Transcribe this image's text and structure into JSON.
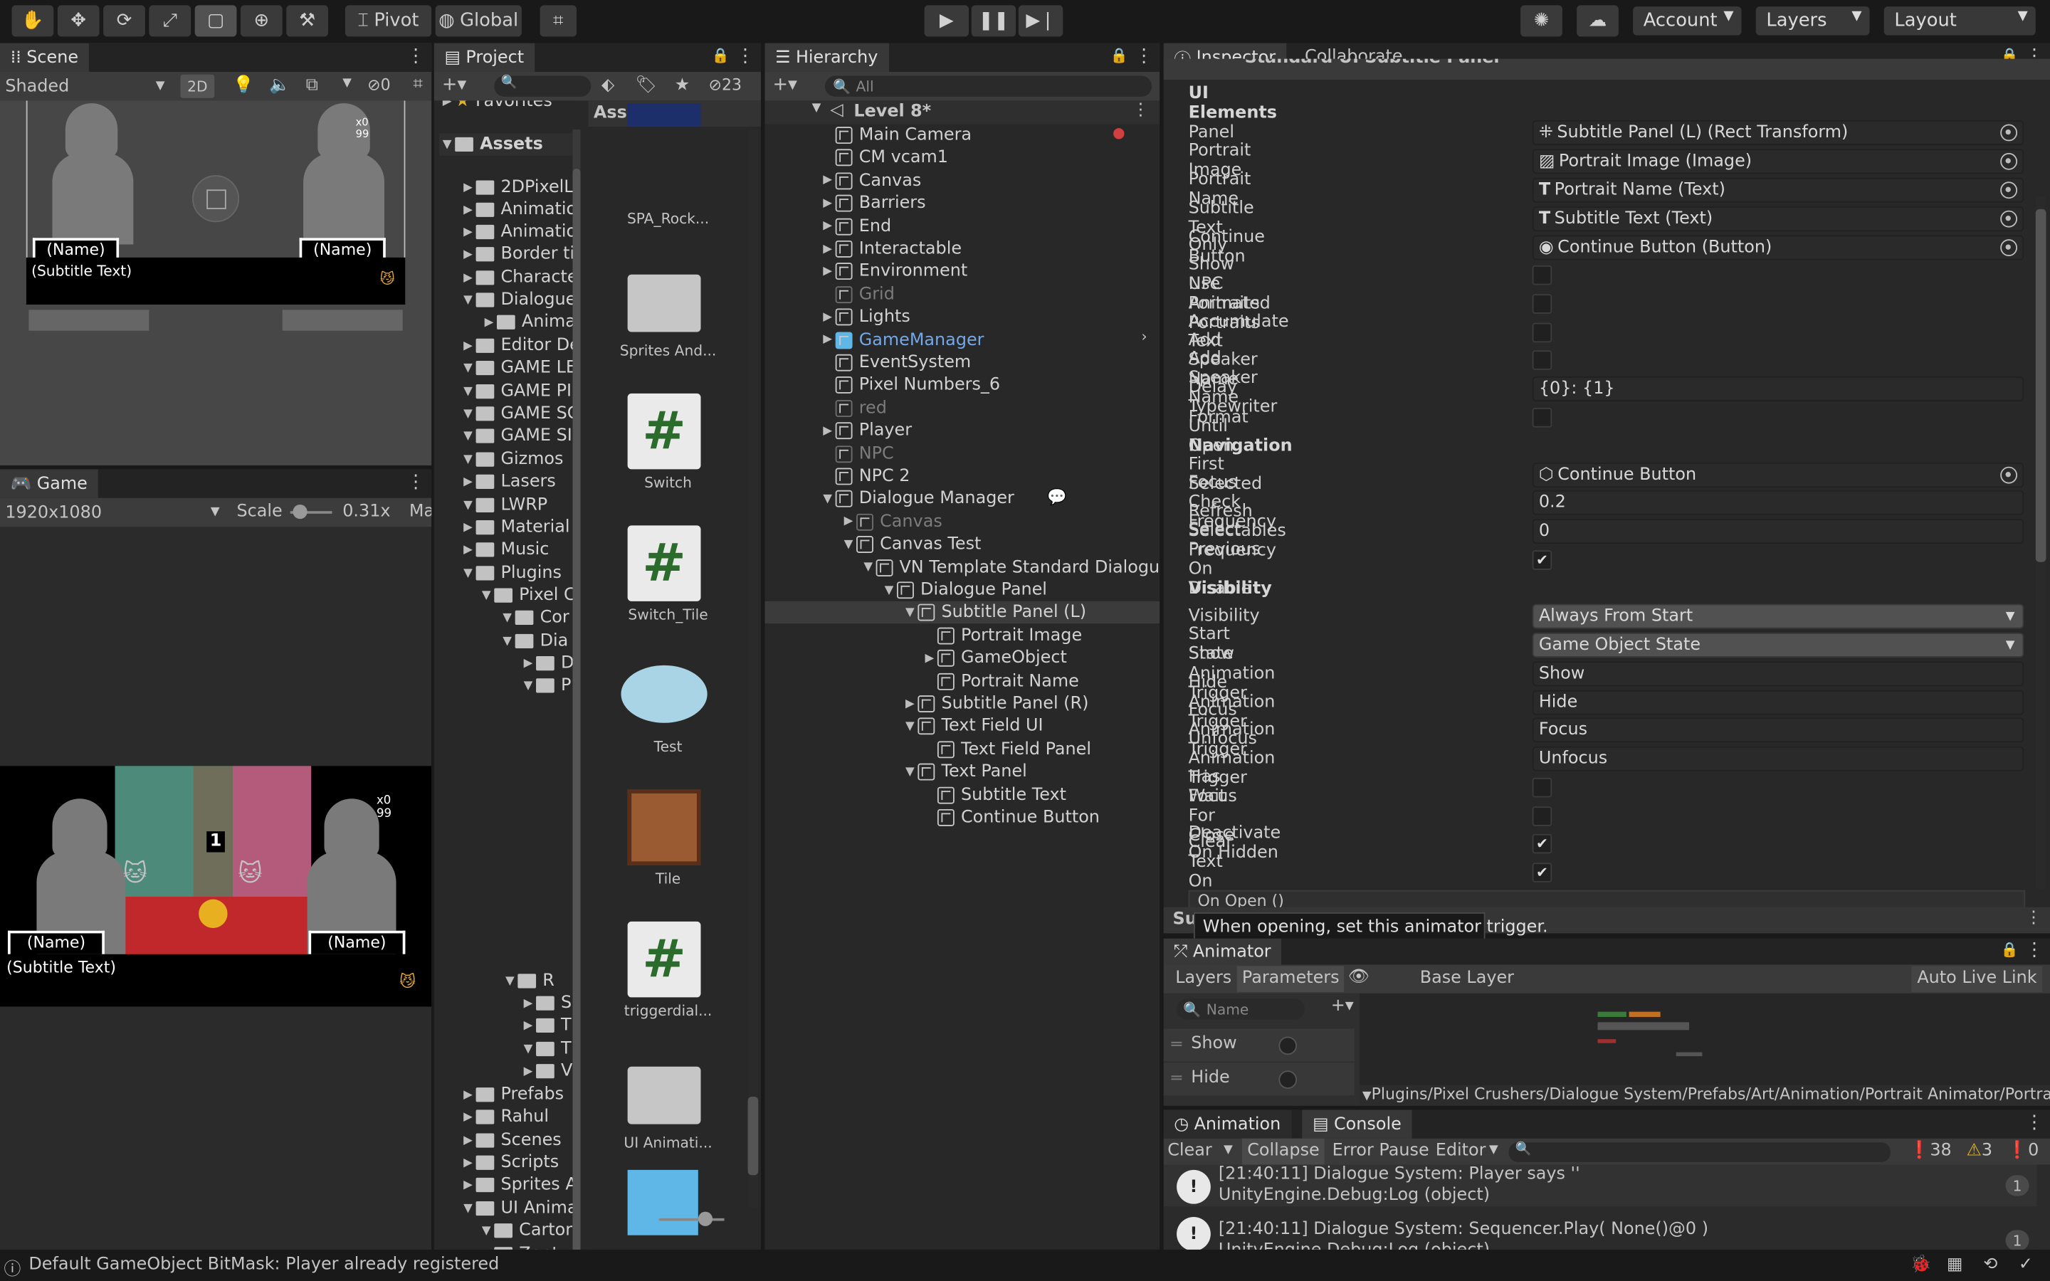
{
  "toolbar": {
    "pivot": "Pivot",
    "global": "Global",
    "account": "Account",
    "layers": "Layers",
    "layout": "Layout"
  },
  "scene": {
    "tab": "Scene",
    "shading": "Shaded",
    "mode2d": "2D",
    "hidden_count": "0",
    "hud_x": "x0",
    "hud_99": "99",
    "name_left": "(Name)",
    "name_right": "(Name)",
    "subtitle": "(Subtitle Text)"
  },
  "game": {
    "tab": "Game",
    "resolution": "1920x1080",
    "scale_label": "Scale",
    "scale_value": "0.31x",
    "maximize": "Ma",
    "hud_x": "x0",
    "hud_99": "99",
    "tile_number": "1",
    "name_left": "(Name)",
    "name_right": "(Name)",
    "subtitle": "(Subtitle Text)"
  },
  "project": {
    "tab": "Project",
    "badge_count": "23",
    "favorites": "Favorites",
    "assets_root": "Assets",
    "assets_header": "Assets",
    "tree": [
      "2DPixelL",
      "Animatio",
      "Animatio",
      "Border ti",
      "Characte",
      "Dialogue",
      "Anima",
      "Editor De",
      "GAME LE",
      "GAME PI",
      "GAME SC",
      "GAME SI",
      "Gizmos",
      "Lasers",
      "LWRP",
      "Material",
      "Music",
      "Plugins",
      "Pixel C",
      "Cor",
      "Dia",
      "D",
      "P",
      "R",
      "S",
      "T",
      "T",
      "V",
      "Prefabs",
      "Rahul",
      "Scenes",
      "Scripts",
      "Sprites A",
      "UI Anima",
      "Cartor",
      "Zent"
    ],
    "items": [
      "SPA_Rock...",
      "Sprites And...",
      "Switch",
      "Switch_Tile",
      "Test",
      "Tile",
      "triggerdial...",
      "UI Animati..."
    ]
  },
  "hierarchy": {
    "tab": "Hierarchy",
    "search_placeholder": "All",
    "scene": "Level 8*",
    "rows": [
      "Main Camera",
      "CM vcam1",
      "Canvas",
      "Barriers",
      "End",
      "Interactable",
      "Environment",
      "Grid",
      "Lights",
      "GameManager",
      "EventSystem",
      "Pixel Numbers_6",
      "red",
      "Player",
      "NPC",
      "NPC 2",
      "Dialogue Manager",
      "Canvas",
      "Canvas Test",
      "VN Template Standard Dialogu",
      "Dialogue Panel",
      "Subtitle Panel (L)",
      "Portrait Image",
      "GameObject",
      "Portrait Name",
      "Subtitle Panel (R)",
      "Text Field UI",
      "Text Field Panel",
      "Text Panel",
      "Subtitle Text",
      "Continue Button"
    ]
  },
  "inspector": {
    "tab": "Inspector",
    "tab2": "Collaborate",
    "component": "Standard UI Subtitle Panel",
    "sec_ui": "UI Elements",
    "sec_nav": "Navigation",
    "sec_vis": "Visibility",
    "panel": "Panel",
    "panel_v": "Subtitle Panel (L) (Rect Transform)",
    "portrait_image": "Portrait Image",
    "portrait_image_v": "Portrait Image (Image)",
    "portrait_name": "Portrait Name",
    "portrait_name_v": "Portrait Name (Text)",
    "subtitle_text": "Subtitle Text",
    "subtitle_text_v": "Subtitle Text (Text)",
    "continue_button": "Continue Button",
    "continue_button_v": "Continue Button (Button)",
    "only_npc": "Only Show NPC Portraits",
    "animated": "Use Animated Portraits",
    "accumulate": "Accumulate Text",
    "add_speaker": "Add Speaker Name",
    "speaker_format": "Add Speaker Name Format",
    "speaker_format_v": "{0}: {1}",
    "delay": "Delay Typewriter Until Open",
    "first_selected": "First Selected",
    "first_selected_v": "Continue Button",
    "focus_freq": "Focus Check Frequency",
    "focus_freq_v": "0.2",
    "refresh_freq": "Refresh Selectables Frequency",
    "refresh_freq_v": "0",
    "select_prev": "Select Previous On Disable",
    "visibility": "Visibility",
    "visibility_v": "Always From Start",
    "start_state": "Start State",
    "start_state_v": "Game Object State",
    "show_trig": "Show Animation Trigger",
    "show_trig_v": "Show",
    "hide_trig": "Hide Animation Trigger",
    "hide_trig_v": "Hide",
    "focus_trig": "Focus Animation Trigger",
    "focus_trig_v": "Focus",
    "unfocus_trig": "Unfocus Animation Trigger",
    "unfocus_trig_v": "Unfocus",
    "has_focus": "Has Focus",
    "wait_close": "Wait For Close",
    "deactivate": "Deactivate On Hidden",
    "clear_text": "Clear Text On Close",
    "on_open": "On Open ()",
    "tooltip": "When opening, set this animator trigger.",
    "collapsed_prefix": "Su"
  },
  "animator": {
    "tab": "Animator",
    "layers": "Layers",
    "parameters": "Parameters",
    "base_layer": "Base Layer",
    "auto_live": "Auto Live Link",
    "search_placeholder": "Name",
    "params": [
      "Show",
      "Hide"
    ],
    "path": "Plugins/Pixel Crushers/Dialogue System/Prefabs/Art/Animation/Portrait Animator/Portrait Animator"
  },
  "console": {
    "tab_anim": "Animation",
    "tab_console": "Console",
    "clear": "Clear",
    "collapse": "Collapse",
    "error_pause": "Error Pause",
    "editor": "Editor",
    "count_log": "38",
    "count_warn": "3",
    "count_err": "0",
    "entries": [
      {
        "line1": "[21:40:11] Dialogue System: Player says ''",
        "line2": "UnityEngine.Debug:Log (object)",
        "count": "1"
      },
      {
        "line1": "[21:40:11] Dialogue System: Sequencer.Play( None()@0 )",
        "line2": "UnityEngine.Debug:Log (object)",
        "count": "1"
      }
    ]
  },
  "status": {
    "message": "Default GameObject BitMask: Player already registered"
  },
  "colors": {
    "accent_blue": "#73a8ea",
    "panel_bg": "#282828",
    "toolbar_bg": "#191919"
  }
}
